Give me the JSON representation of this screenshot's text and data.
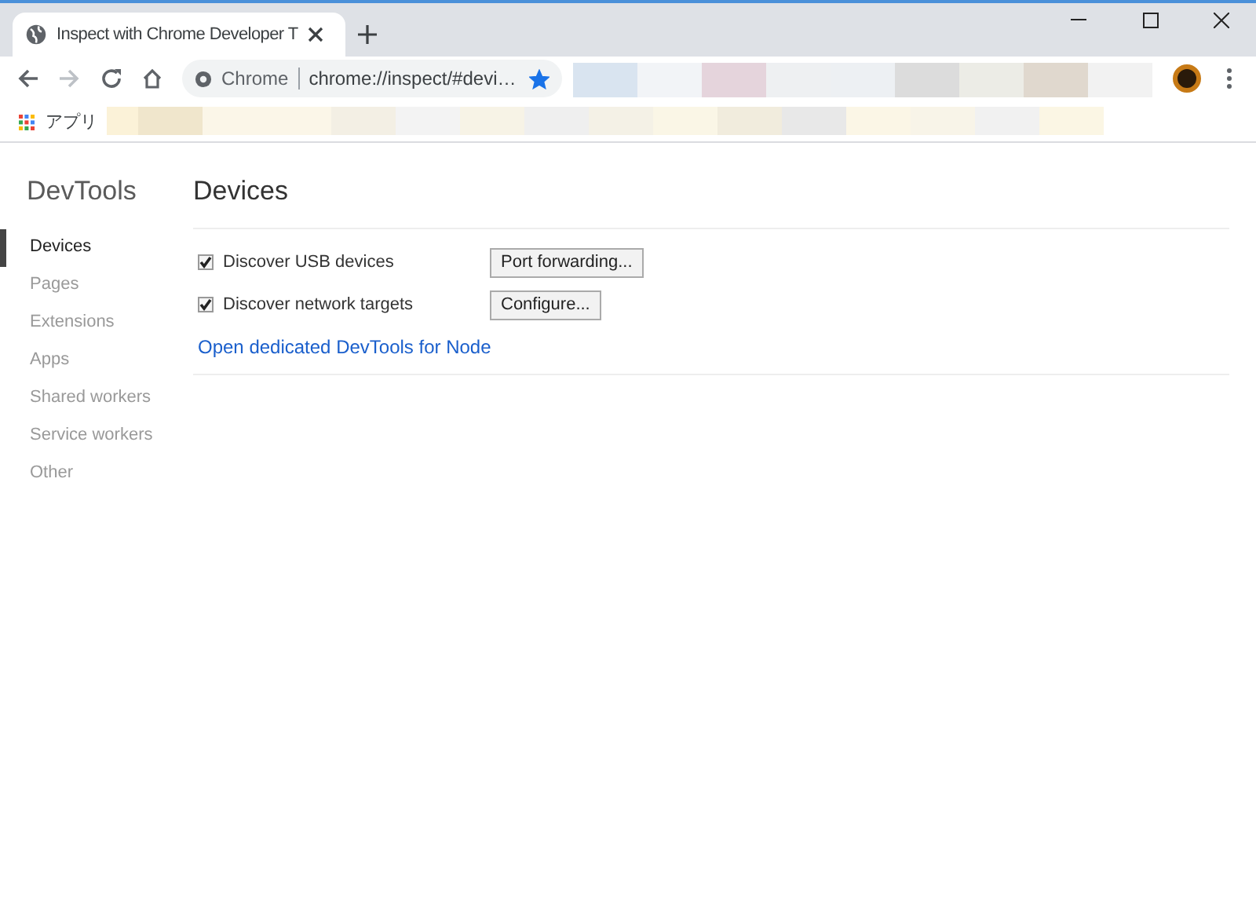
{
  "tab": {
    "title": "Inspect with Chrome Developer T",
    "selected": true
  },
  "toolbar": {
    "site_label": "Chrome",
    "url": "chrome://inspect/#devi…",
    "bookmarked": true
  },
  "bookmarks_bar": {
    "apps_label": "アプリ"
  },
  "sidebar": {
    "title": "DevTools",
    "items": [
      {
        "label": "Devices",
        "selected": true
      },
      {
        "label": "Pages",
        "selected": false
      },
      {
        "label": "Extensions",
        "selected": false
      },
      {
        "label": "Apps",
        "selected": false
      },
      {
        "label": "Shared workers",
        "selected": false
      },
      {
        "label": "Service workers",
        "selected": false
      },
      {
        "label": "Other",
        "selected": false
      }
    ]
  },
  "main": {
    "heading": "Devices",
    "options": [
      {
        "label": "Discover USB devices",
        "checked": true,
        "button": "Port forwarding..."
      },
      {
        "label": "Discover network targets",
        "checked": true,
        "button": "Configure..."
      }
    ],
    "link": "Open dedicated DevTools for Node"
  }
}
